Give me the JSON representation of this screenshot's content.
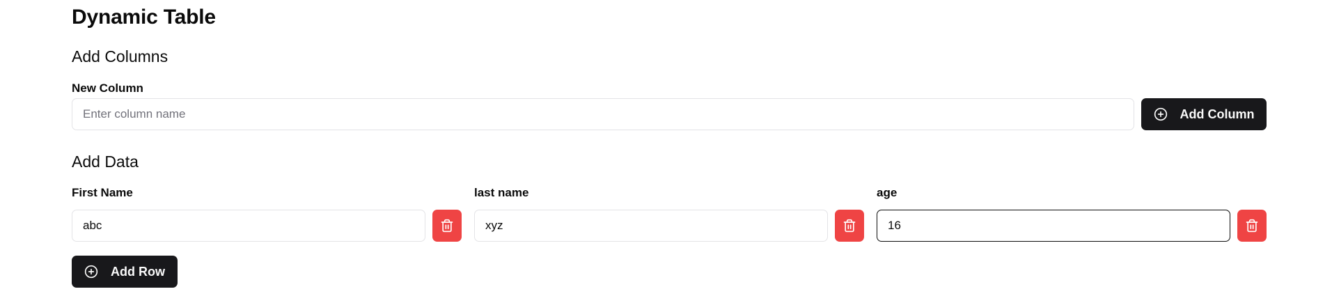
{
  "page": {
    "title": "Dynamic Table"
  },
  "add_columns": {
    "heading": "Add Columns",
    "new_column_label": "New Column",
    "input_placeholder": "Enter column name",
    "input_value": "",
    "add_column_label": "Add Column"
  },
  "add_data": {
    "heading": "Add Data",
    "columns": [
      {
        "label": "First Name",
        "value": "abc"
      },
      {
        "label": "last name",
        "value": "xyz"
      },
      {
        "label": "age",
        "value": "16"
      }
    ],
    "add_row_label": "Add Row"
  },
  "icons": {
    "add": "plus-circle-icon",
    "delete": "trash-icon"
  },
  "colors": {
    "primary_button": "#18181b",
    "delete_button": "#ef4444",
    "focus_border": "#0a0a0a"
  }
}
